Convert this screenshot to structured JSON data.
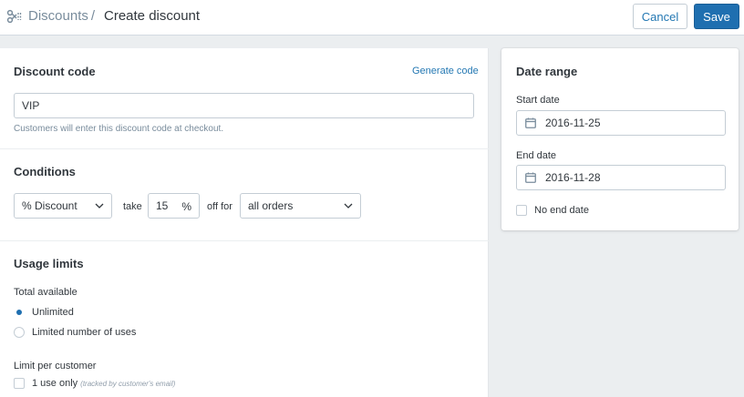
{
  "header": {
    "breadcrumb": "Discounts",
    "separator": "/",
    "title": "Create discount",
    "cancel_label": "Cancel",
    "save_label": "Save"
  },
  "discount_code": {
    "heading": "Discount code",
    "generate_label": "Generate code",
    "value": "VIP",
    "help": "Customers will enter this discount code at checkout."
  },
  "conditions": {
    "heading": "Conditions",
    "type_selected": "% Discount",
    "take_label": "take",
    "amount": "15",
    "amount_suffix": "%",
    "off_for_label": "off for",
    "applies_selected": "all orders"
  },
  "usage_limits": {
    "heading": "Usage limits",
    "total_label": "Total available",
    "options": [
      "Unlimited",
      "Limited number of uses"
    ],
    "selected_index": 0,
    "per_customer_label": "Limit per customer",
    "one_use_label": "1 use only",
    "one_use_hint": "(tracked by customer's email)"
  },
  "date_range": {
    "heading": "Date range",
    "start_label": "Start date",
    "start_value": "2016-11-25",
    "end_label": "End date",
    "end_value": "2016-11-28",
    "no_end_label": "No end date"
  },
  "colors": {
    "accent": "#1f6fb0",
    "link": "#2478b3",
    "background": "#ebeef0"
  },
  "icons": {
    "breadcrumb": "discount-scissors-icon",
    "calendar": "calendar-icon",
    "dropdown": "chevron-down-icon"
  }
}
